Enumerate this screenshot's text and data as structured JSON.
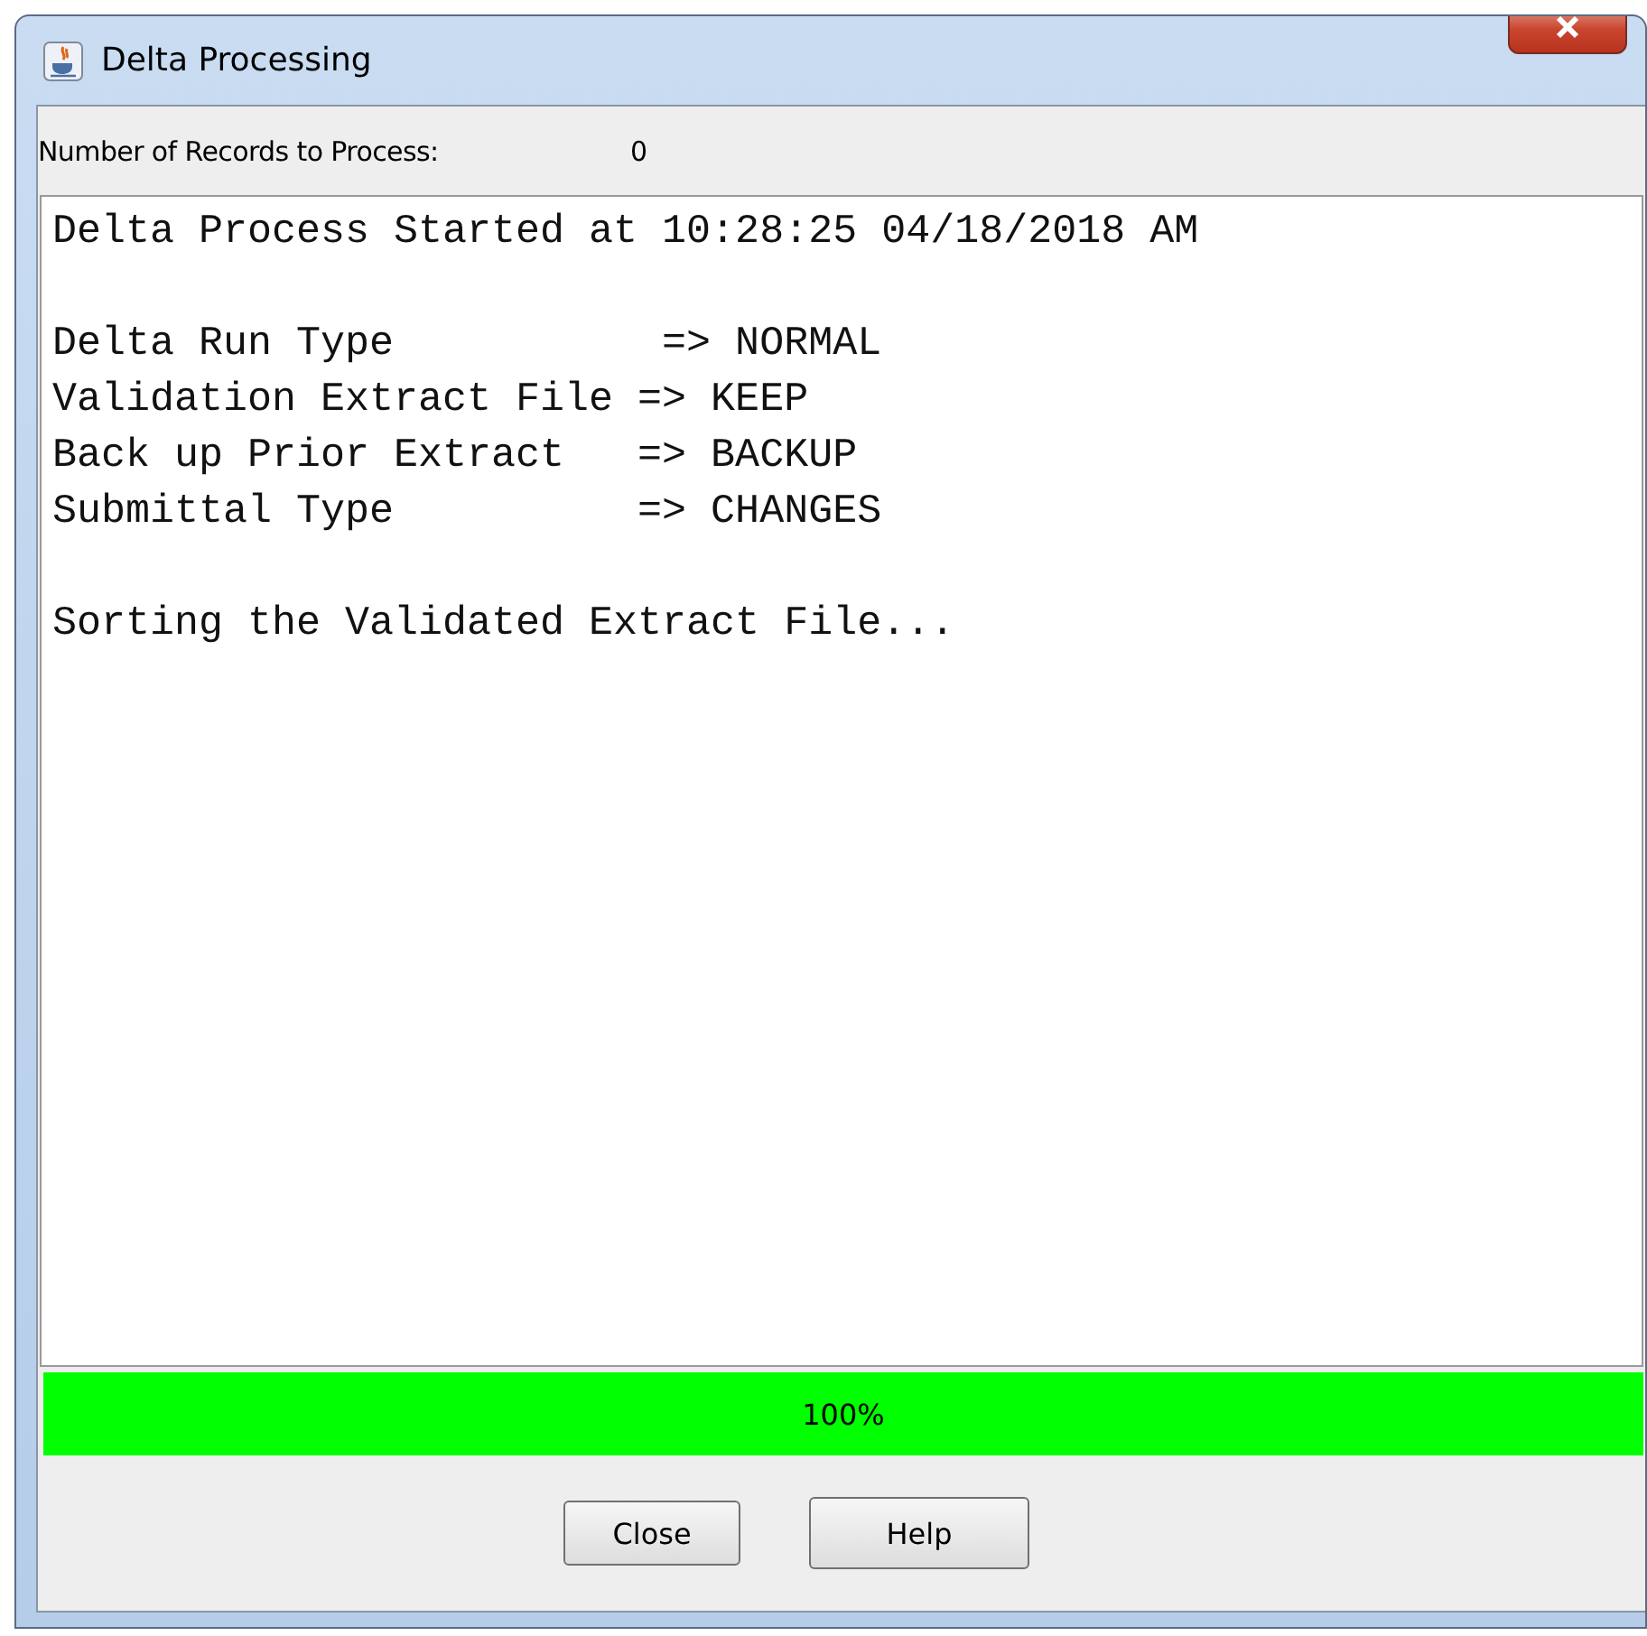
{
  "window": {
    "title": "Delta Processing"
  },
  "records": {
    "label": "Number of Records to Process:",
    "value": "0"
  },
  "log": {
    "blocks": [
      [
        "Delta Process Started at 10:28:25 04/18/2018 AM"
      ],
      [
        "Delta Run Type           => NORMAL",
        "Validation Extract File => KEEP",
        "Back up Prior Extract   => BACKUP",
        "Submittal Type          => CHANGES"
      ],
      [
        "Sorting the Validated Extract File..."
      ]
    ]
  },
  "progress": {
    "level": 1,
    "reading": "100%"
  },
  "buttons": [
    "Close",
    "Help"
  ]
}
